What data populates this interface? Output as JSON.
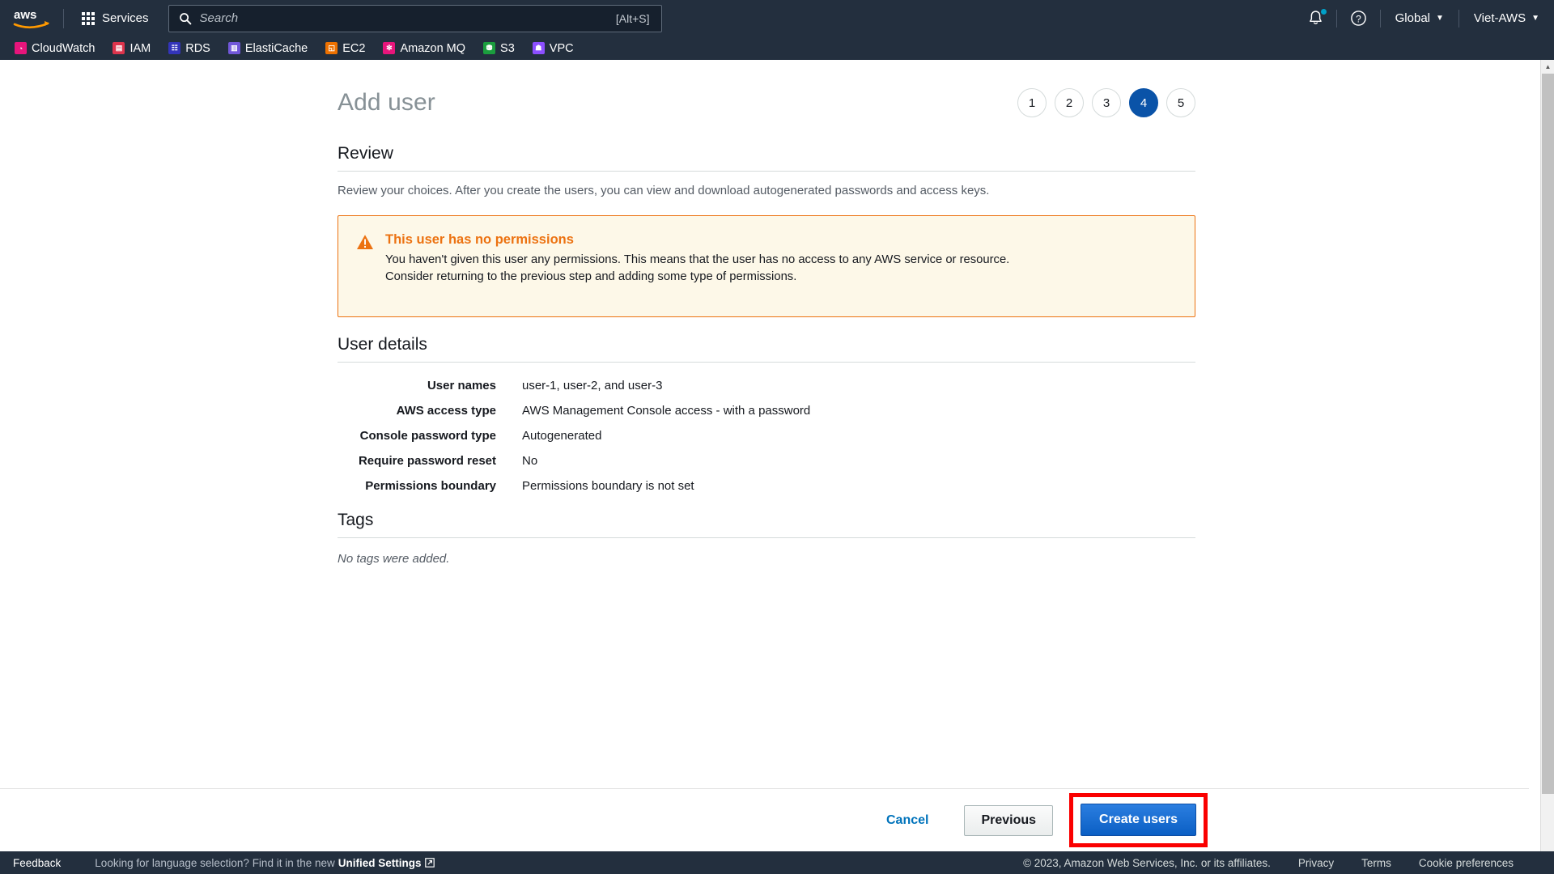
{
  "nav": {
    "logo_alt": "aws",
    "services_label": "Services",
    "search_placeholder": "Search",
    "search_value": "",
    "search_shortcut": "[Alt+S]",
    "bell_icon": "notifications-bell-icon",
    "help_icon": "help-question-icon",
    "region_label": "Global",
    "account_label": "Viet-AWS",
    "caret": "▼"
  },
  "favorites": [
    {
      "label": "CloudWatch",
      "color": "#e7157b",
      "glyph": "◔"
    },
    {
      "label": "IAM",
      "color": "#dd344c",
      "glyph": "▤"
    },
    {
      "label": "RDS",
      "color": "#3334b9",
      "glyph": "☷"
    },
    {
      "label": "ElastiCache",
      "color": "#7157d9",
      "glyph": "▥"
    },
    {
      "label": "EC2",
      "color": "#ed7100",
      "glyph": "◱"
    },
    {
      "label": "Amazon MQ",
      "color": "#e7157b",
      "glyph": "✻"
    },
    {
      "label": "S3",
      "color": "#1b9e3e",
      "glyph": "⛃"
    },
    {
      "label": "VPC",
      "color": "#8c4fff",
      "glyph": "☗"
    }
  ],
  "page": {
    "title": "Add user",
    "steps": [
      {
        "number": "1",
        "active": false
      },
      {
        "number": "2",
        "active": false
      },
      {
        "number": "3",
        "active": false
      },
      {
        "number": "4",
        "active": true
      },
      {
        "number": "5",
        "active": false
      }
    ],
    "review_heading": "Review",
    "review_description": "Review your choices. After you create the users, you can view and download autogenerated passwords and access keys."
  },
  "warning": {
    "icon": "warning-triangle-icon",
    "title": "This user has no permissions",
    "body": "You haven't given this user any permissions. This means that the user has no access to any AWS service or resource. Consider returning to the previous step and adding some type of permissions.",
    "border_color": "#ec7211",
    "background_color": "#fdf8e8",
    "title_color": "#ec7211"
  },
  "user_details": {
    "heading": "User details",
    "rows": [
      {
        "label": "User names",
        "value": "user-1, user-2, and user-3"
      },
      {
        "label": "AWS access type",
        "value": "AWS Management Console access - with a password"
      },
      {
        "label": "Console password type",
        "value": "Autogenerated"
      },
      {
        "label": "Require password reset",
        "value": "No"
      },
      {
        "label": "Permissions boundary",
        "value": "Permissions boundary is not set"
      }
    ]
  },
  "tags": {
    "heading": "Tags",
    "empty_text": "No tags were added."
  },
  "actions": {
    "cancel_label": "Cancel",
    "previous_label": "Previous",
    "create_label": "Create users",
    "highlight_color": "#fa0000",
    "primary_color": "#0b5fc4"
  },
  "footer": {
    "feedback_label": "Feedback",
    "language_note_prefix": "Looking for language selection? Find it in the new ",
    "language_note_link": "Unified Settings",
    "external_link_icon": "external-link-icon",
    "copyright": "© 2023, Amazon Web Services, Inc. or its affiliates.",
    "privacy_label": "Privacy",
    "terms_label": "Terms",
    "cookie_label": "Cookie preferences"
  },
  "scrollbar": {
    "up_glyph": "▲",
    "down_glyph": "▼"
  }
}
